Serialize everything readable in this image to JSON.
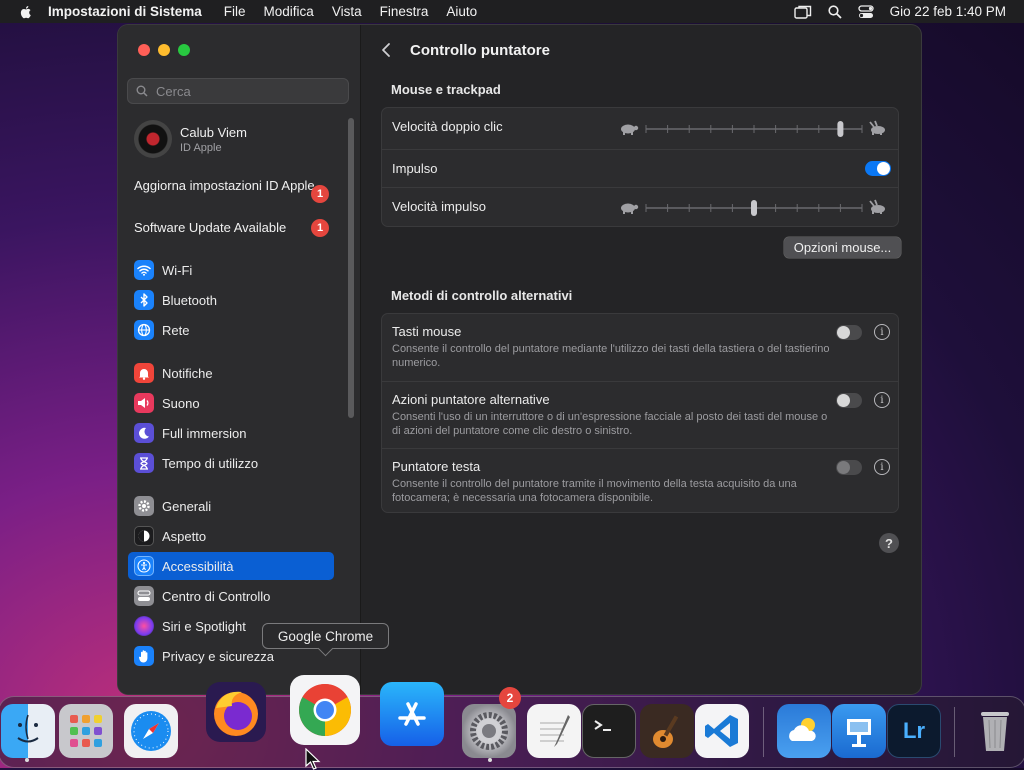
{
  "menubar": {
    "app": "Impostazioni di Sistema",
    "menus": [
      "File",
      "Modifica",
      "Vista",
      "Finestra",
      "Aiuto"
    ],
    "datetime": "Gio 22 feb  1:40 PM"
  },
  "sidebar": {
    "search_placeholder": "Cerca",
    "user": {
      "name": "Calub Viem",
      "subtitle": "ID Apple"
    },
    "notices": [
      {
        "label": "Aggiorna impostazioni ID Apple",
        "badge": "1"
      },
      {
        "label": "Software Update Available",
        "badge": "1"
      }
    ],
    "items": [
      {
        "label": "Wi-Fi",
        "icon": "wifi-icon",
        "color": "#1a82fb"
      },
      {
        "label": "Bluetooth",
        "icon": "bluetooth-icon",
        "color": "#1a82fb"
      },
      {
        "label": "Rete",
        "icon": "globe-icon",
        "color": "#1a82fb"
      },
      {
        "label": "Notifiche",
        "icon": "bell-icon",
        "color": "#f0453a"
      },
      {
        "label": "Suono",
        "icon": "speaker-icon",
        "color": "#e8395d"
      },
      {
        "label": "Full immersion",
        "icon": "moon-icon",
        "color": "#5b4fd6"
      },
      {
        "label": "Tempo di utilizzo",
        "icon": "hourglass-icon",
        "color": "#5b4fd6"
      },
      {
        "label": "Generali",
        "icon": "gear-icon",
        "color": "#8e8e93"
      },
      {
        "label": "Aspetto",
        "icon": "appearance-icon",
        "color": "#1c1c1e"
      },
      {
        "label": "Accessibilità",
        "icon": "accessibility-icon",
        "color": "#1a82fb",
        "selected": true
      },
      {
        "label": "Centro di Controllo",
        "icon": "control-center-icon",
        "color": "#8e8e93"
      },
      {
        "label": "Siri e Spotlight",
        "icon": "siri-icon",
        "color": "#b14cd8"
      },
      {
        "label": "Privacy e sicurezza",
        "icon": "hand-icon",
        "color": "#1a82fb"
      }
    ]
  },
  "content": {
    "title": "Controllo puntatore",
    "section1": {
      "header": "Mouse e trackpad",
      "rows": [
        {
          "label": "Velocità doppio clic",
          "value": 0.9
        },
        {
          "label": "Impulso",
          "on": true
        },
        {
          "label": "Velocità impulso",
          "value": 0.5
        }
      ],
      "button": "Opzioni mouse..."
    },
    "section2": {
      "header": "Metodi di controllo alternativi",
      "rows": [
        {
          "label": "Tasti mouse",
          "desc": "Consente il controllo del puntatore mediante l'utilizzo dei tasti della tastiera o del tastierino numerico.",
          "on": false
        },
        {
          "label": "Azioni puntatore alternative",
          "desc": "Consenti l'uso di un interruttore o di un'espressione facciale al posto dei tasti del mouse o di azioni del puntatore come clic destro o sinistro.",
          "on": false
        },
        {
          "label": "Puntatore testa",
          "desc": "Consente il controllo del puntatore tramite il movimento della testa acquisito da una fotocamera; è necessaria una fotocamera disponibile.",
          "on": false
        }
      ]
    },
    "help": "?"
  },
  "tooltip": "Google Chrome",
  "dock": {
    "apps": [
      "finder-icon",
      "launchpad-icon",
      "safari-icon",
      "firefox-icon",
      "chrome-icon",
      "app-store-icon",
      "system-settings-icon",
      "textedit-icon",
      "terminal-icon",
      "garageband-icon",
      "vscode-icon",
      "weather-icon",
      "keynote-icon",
      "lightroom-icon",
      "trash-icon"
    ],
    "settings_badge": "2",
    "lightroom_label": "Lr"
  }
}
